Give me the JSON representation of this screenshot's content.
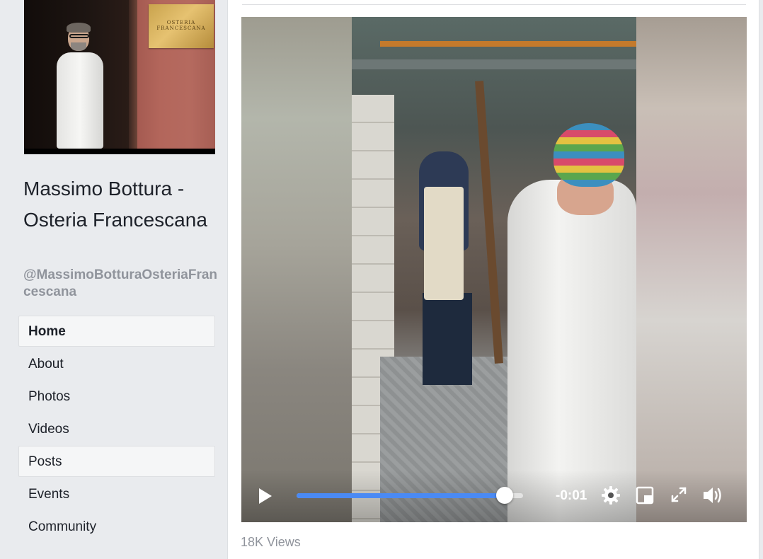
{
  "page": {
    "name": "Massimo Bottura - Osteria Francescana",
    "handle": "@MassimoBotturaOsteriaFrancescana",
    "cover_sign_line1": "OSTERIA",
    "cover_sign_line2": "FRANCESCANA"
  },
  "nav": {
    "items": [
      {
        "label": "Home"
      },
      {
        "label": "About"
      },
      {
        "label": "Photos"
      },
      {
        "label": "Videos"
      },
      {
        "label": "Posts"
      },
      {
        "label": "Events"
      },
      {
        "label": "Community"
      }
    ]
  },
  "video": {
    "time_remaining": "-0:01",
    "progress_percent": 92,
    "views": "18K Views"
  },
  "colors": {
    "progress_fill": "#4a8af4",
    "background": "#e9ebee",
    "secondary_text": "#90949c"
  },
  "icons": [
    "play-icon",
    "settings-gear-icon",
    "picture-in-picture-icon",
    "fullscreen-icon",
    "volume-icon"
  ]
}
